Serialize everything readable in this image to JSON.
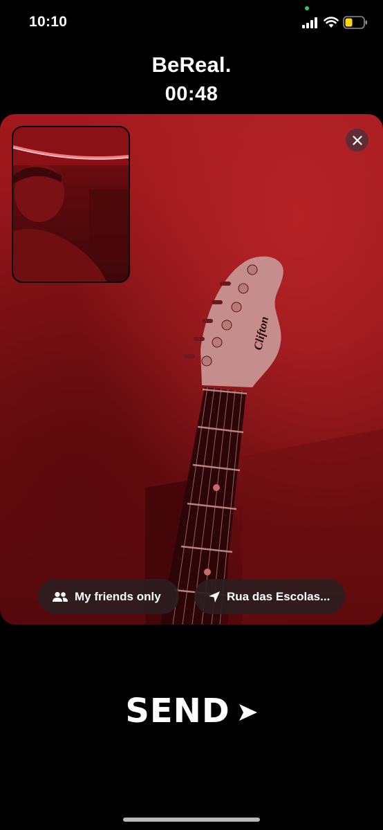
{
  "status_bar": {
    "time": "10:10",
    "icons": [
      "camera-active-dot",
      "cellular-signal-icon",
      "wifi-icon",
      "battery-icon"
    ],
    "colors": {
      "camera_dot": "#34c759",
      "battery_fill": "#ffd60a"
    }
  },
  "header": {
    "brand": "BeReal.",
    "countdown": "00:48"
  },
  "photo": {
    "main_camera": "back-camera-guitar-headstock",
    "inset_camera": "front-camera-selfie",
    "guitar_brand_text": "Clifton",
    "close_icon": "close-icon"
  },
  "options": {
    "audience": {
      "icon": "people-icon",
      "label": "My friends only"
    },
    "location": {
      "icon": "location-arrow-icon",
      "label": "Rua das Escolas..."
    }
  },
  "send": {
    "label": "SEND",
    "icon": "send-arrow-icon"
  },
  "colors": {
    "background": "#000000",
    "photo_tint": "#a3191d",
    "pill_bg": "#2d1e20",
    "text": "#ffffff"
  }
}
